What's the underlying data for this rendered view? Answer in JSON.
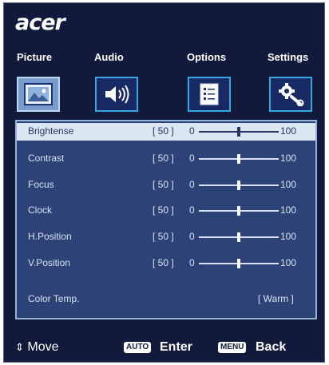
{
  "brand": {
    "logo_text": "acer"
  },
  "tabs": [
    {
      "label": "Picture",
      "icon": "picture-icon",
      "active": true
    },
    {
      "label": "Audio",
      "icon": "speaker-icon",
      "active": false
    },
    {
      "label": "Options",
      "icon": "document-icon",
      "active": false
    },
    {
      "label": "Settings",
      "icon": "gear-wrench-icon",
      "active": false
    }
  ],
  "settings": [
    {
      "label": "Brightense",
      "value": "[ 50 ]",
      "level": 50,
      "min": "0",
      "max": "100",
      "selected": true
    },
    {
      "label": "Contrast",
      "value": "[ 50 ]",
      "level": 50,
      "min": "0",
      "max": "100",
      "selected": false
    },
    {
      "label": "Focus",
      "value": "[ 50 ]",
      "level": 50,
      "min": "0",
      "max": "100",
      "selected": false
    },
    {
      "label": "Clock",
      "value": "[ 50 ]",
      "level": 50,
      "min": "0",
      "max": "100",
      "selected": false
    },
    {
      "label": "H.Position",
      "value": "[ 50 ]",
      "level": 50,
      "min": "0",
      "max": "100",
      "selected": false
    },
    {
      "label": "V.Position",
      "value": "[ 50 ]",
      "level": 50,
      "min": "0",
      "max": "100",
      "selected": false
    }
  ],
  "color_temp": {
    "label": "Color Temp.",
    "value": "[ Warm ]"
  },
  "footer": {
    "move_label": "Move",
    "auto_key": "AUTO",
    "enter_label": "Enter",
    "menu_key": "MENU",
    "back_label": "Back"
  },
  "colors": {
    "background": "#111a3a",
    "panel": "#2d4378",
    "accent": "#3aa6de",
    "selected_row": "#dbe6f3"
  }
}
